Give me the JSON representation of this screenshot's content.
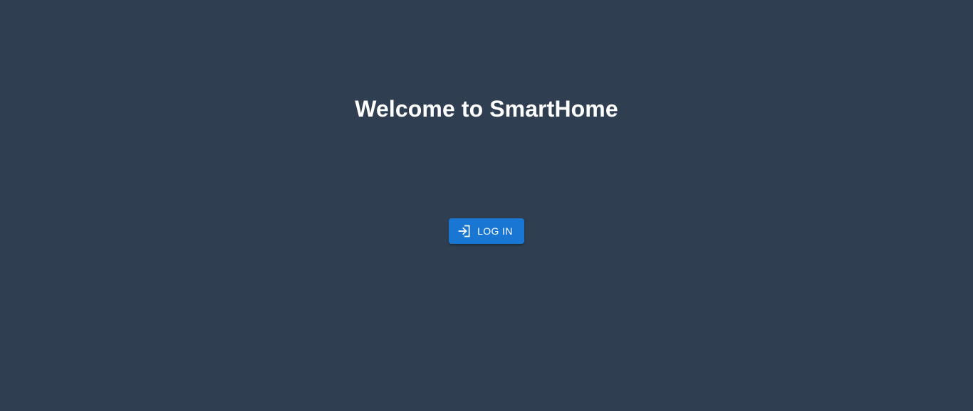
{
  "welcome": {
    "title": "Welcome to SmartHome"
  },
  "login": {
    "label": "LOG IN",
    "icon": "login-icon"
  },
  "colors": {
    "background": "#2f3f51",
    "button": "#1976d2",
    "text": "#ffffff"
  }
}
